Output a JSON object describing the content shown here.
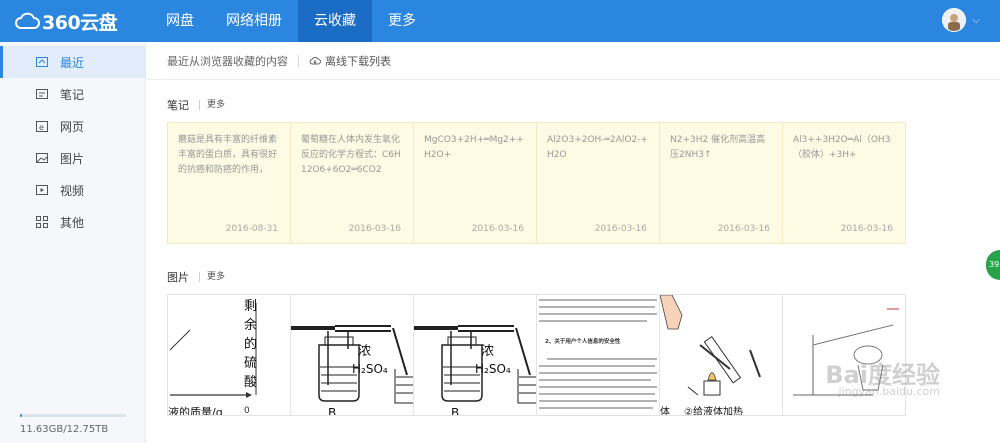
{
  "header": {
    "logo_text": "360云盘",
    "nav": [
      "网盘",
      "网络相册",
      "云收藏",
      "更多"
    ],
    "active_nav": 2
  },
  "sidebar": {
    "items": [
      {
        "label": "最近",
        "icon": "recent-icon"
      },
      {
        "label": "笔记",
        "icon": "note-icon"
      },
      {
        "label": "网页",
        "icon": "webpage-icon"
      },
      {
        "label": "图片",
        "icon": "image-icon"
      },
      {
        "label": "视频",
        "icon": "video-icon"
      },
      {
        "label": "其他",
        "icon": "other-icon"
      }
    ],
    "active_index": 0,
    "quota_text": "11.63GB/12.75TB",
    "quota_fraction": 0.001
  },
  "subbar": {
    "description": "最近从浏览器收藏的内容",
    "download_label": "离线下载列表"
  },
  "notes_section": {
    "title": "笔记",
    "more": "更多",
    "items": [
      {
        "text": "蘑菇是具有丰富的纤维素丰富的蛋白质，具有很好的抗癌和防癌的作用，",
        "date": "2016-08-31"
      },
      {
        "text": "葡萄糖在人体内发生氧化反应的化学方程式：C6H12O6+6O2═6CO2",
        "date": "2016-03-16"
      },
      {
        "text": "MgCO3+2H+═Mg2++H2O+",
        "date": "2016-03-16"
      },
      {
        "text": "Al2O3+2OH-═2AlO2-+H2O",
        "date": "2016-03-16"
      },
      {
        "text": "N2+3H2 催化剂高温高压2NH3↑",
        "date": "2016-03-16"
      },
      {
        "text": "Al3++3H2O═Al（OH3（胶体）+3H+",
        "date": "2016-03-16"
      }
    ]
  },
  "images_section": {
    "title": "图片",
    "more": "更多",
    "thumb1": {
      "vertical_text": "剩余的硫酸",
      "axis_label": "液的质量/g",
      "zero": "0"
    },
    "thumb2": {
      "label": "浓",
      "formula": "H₂SO₄",
      "letter": "B"
    },
    "thumb3": {
      "label": "浓",
      "formula": "H₂SO₄",
      "letter": "B"
    },
    "thumb4": {
      "heading": "2、关于用户个人信息的安全性"
    },
    "thumb5": {
      "caption": "②给液体加热",
      "left": "体"
    },
    "thumb6": {}
  },
  "badge": "39",
  "watermark": {
    "brand": "Bai度经验",
    "url": "jingyan.baidu.com"
  }
}
